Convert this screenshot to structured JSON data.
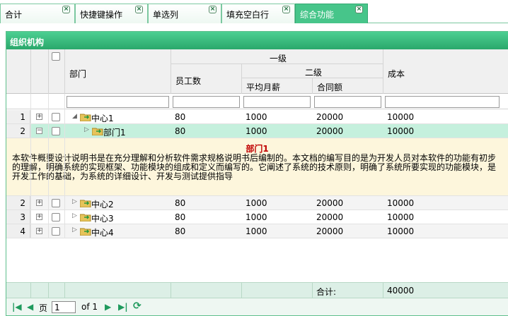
{
  "tabs": [
    {
      "label": "合计",
      "active": false
    },
    {
      "label": "快捷键操作",
      "active": false
    },
    {
      "label": "单选列",
      "active": false
    },
    {
      "label": "填充空白行",
      "active": false
    },
    {
      "label": "综合功能",
      "active": true
    }
  ],
  "tab_close_glyph": "×",
  "panel": {
    "title": "组织机构"
  },
  "header": {
    "dept": "部门",
    "group1": "一级",
    "employees": "员工数",
    "group2": "二级",
    "avg_salary": "平均月薪",
    "contract": "合同额",
    "cost": "成本"
  },
  "rows_top": [
    {
      "num": "1",
      "name": "中心1",
      "employees": "80",
      "avg_salary": "1000",
      "contract": "20000",
      "cost": "10000",
      "expanded": true
    },
    {
      "num": "2",
      "name": "部门1",
      "employees": "80",
      "avg_salary": "1000",
      "contract": "20000",
      "cost": "10000",
      "selected": true
    }
  ],
  "detail": {
    "title": "部门1",
    "text": "本软件概要设计说明书是在充分理解和分析软件需求规格说明书后编制的。本文档的编写目的是为开发人员对本软件的功能有初步的理解，明确系统的实现框架、功能模块的组成和定义而编写的。它阐述了系统的技术原则，明确了系统所要实现的功能模块，是开发工作的基础，为系统的详细设计、开发与测试提供指导"
  },
  "rows_bottom": [
    {
      "num": "2",
      "name": "中心2",
      "employees": "80",
      "avg_salary": "1000",
      "contract": "20000",
      "cost": "10000"
    },
    {
      "num": "3",
      "name": "中心3",
      "employees": "80",
      "avg_salary": "1000",
      "contract": "20000",
      "cost": "10000"
    },
    {
      "num": "4",
      "name": "中心4",
      "employees": "80",
      "avg_salary": "1000",
      "contract": "20000",
      "cost": "10000"
    }
  ],
  "summary": {
    "label": "合计:",
    "value": "40000"
  },
  "pager": {
    "page_label": "页",
    "page_value": "1",
    "of_label": "of 1"
  },
  "colors": {
    "accent": "#2aa86b",
    "selected_row": "#c5f0dd",
    "detail_bg": "#fdf6dc",
    "detail_title": "#c00000"
  }
}
